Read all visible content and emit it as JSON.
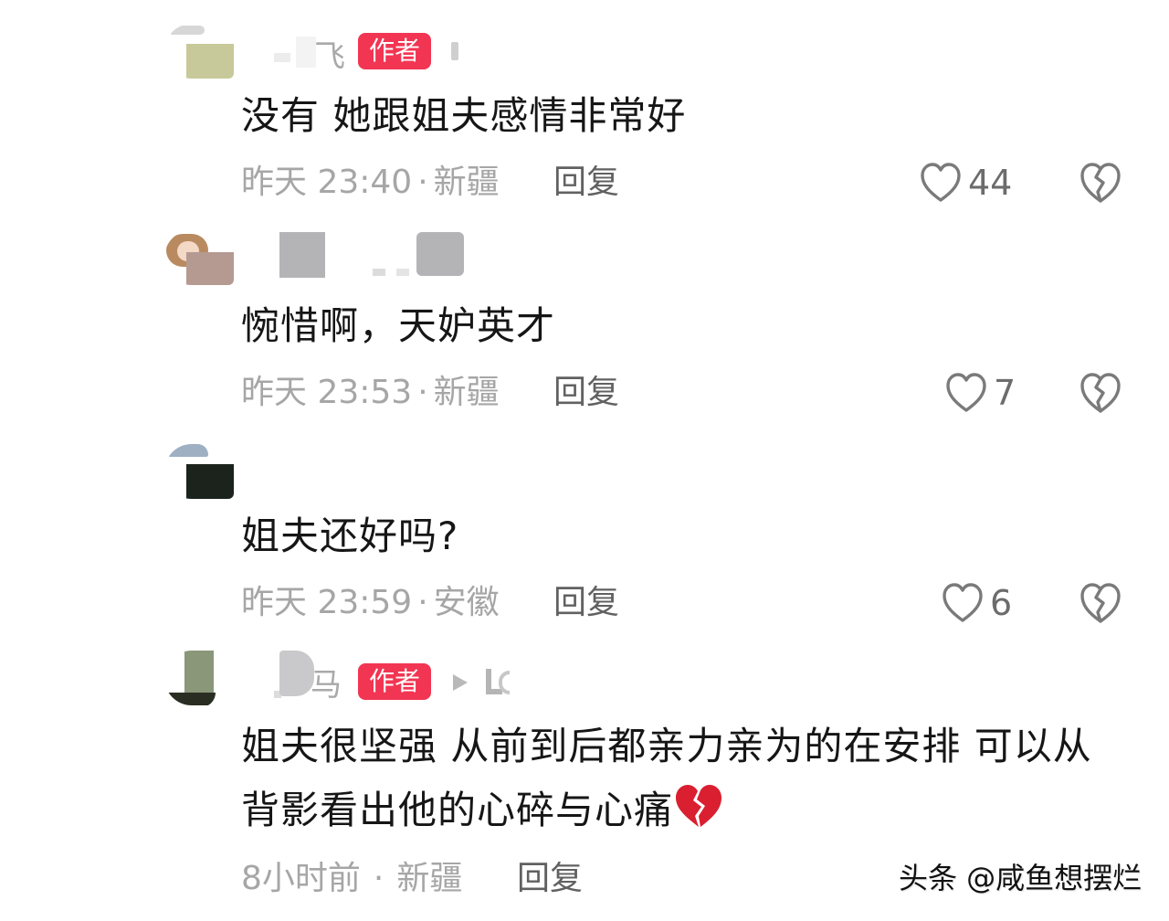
{
  "comments": [
    {
      "username_tail": "飞",
      "badge": "作者",
      "text": "没有 她跟姐夫感情非常好",
      "time": "昨天 23:40",
      "location": "新疆",
      "reply_label": "回复",
      "likes": "44"
    },
    {
      "text": "惋惜啊，天妒英才",
      "time": "昨天 23:53",
      "location": "新疆",
      "reply_label": "回复",
      "likes": "7"
    },
    {
      "text": "姐夫还好吗?",
      "time": "昨天 23:59",
      "location": "安徽",
      "reply_label": "回复",
      "likes": "6"
    },
    {
      "username_tail": "马",
      "badge": "作者",
      "text_line1": "姐夫很坚强 从前到后都亲力亲为的在安排 可以从",
      "text_line2": "背影看出他的心碎与心痛",
      "time": "8小时前",
      "location": "新疆",
      "reply_label": "回复"
    }
  ],
  "meta_separator": "·",
  "watermark": "头条 @咸鱼想摆烂",
  "colors": {
    "badge": "#f23553",
    "meta_text": "#a6a6a6",
    "reply_text": "#616161",
    "icon_stroke": "#7a7a7a"
  },
  "icons": {
    "like": "heart-outline-icon",
    "dislike": "broken-heart-outline-icon",
    "emoji": "broken-heart-emoji"
  }
}
